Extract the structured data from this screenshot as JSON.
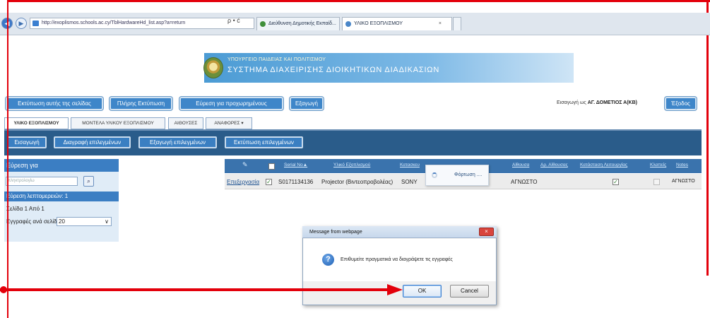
{
  "browser": {
    "url": "http://exoplismos.schools.ac.cy/TblHardwareHd_list.asp?a=return",
    "address_tools": "ρ • ć",
    "tabs": [
      {
        "label": "Διεύθυνση Δημοτικής Εκπαίδ..."
      },
      {
        "label": "ΥΛΙΚΟ ΕΞΟΠΛΙΣΜΟΥ",
        "close": "×"
      }
    ]
  },
  "banner": {
    "line1": "ΥΠΟΥΡΓΕΙΟ ΠΑΙΔΕΙΑΣ ΚΑΙ ΠΟΛΙΤΙΣΜΟΥ",
    "line2": "ΣΥΣΤΗΜΑ ΔΙΑΧΕΙΡΙΣΗΣ ΔΙΟΙΚΗΤΙΚΩΝ ΔΙΑΔΙΚΑΣΙΩΝ"
  },
  "toolbar": {
    "print_page": "Εκτύπωση αυτής της σελίδας",
    "print_all": "Πλήρης Εκτύπωση",
    "advanced_search": "Εύρεση για προχωρημένους",
    "export": "Εξαγωγή",
    "login_prefix": "Εισαγωγή ως",
    "login_user": "ΑΓ. ΔΟΜΕΤΙΟΣ Α(ΚΒ)",
    "logout": "Έξοδος"
  },
  "main_tabs": [
    "ΥΛΙΚΟ ΕΞΟΠΛΙΣΜΟΥ",
    "ΜΟΝΤΕΛΑ ΥΛΙΚΟΥ ΕΞΟΠΛΙΣΜΟΥ",
    "ΑΙΘΟΥΣΕΣ",
    "ΑΝΑΦΟΡΕΣ ▾"
  ],
  "actions": {
    "import": "Εισαγωγή",
    "delete_selected": "Διαγραφή επιλεγμένων",
    "export_selected": "Εξαγωγή επιλεγμένων",
    "print_selected": "Εκτύπωση επιλεγμένων"
  },
  "search_panel": {
    "header": "Εύρεση για",
    "input_value": "πληκτρολογίω",
    "search_icon": "⌕",
    "details": "Εύρεση λεπτομερειών: 1",
    "page": "Σελίδα 1 Από 1",
    "per_page_label": "Εγγραφές ανά σελίδα",
    "per_page_value": "20",
    "caret": "∨"
  },
  "table": {
    "headers": {
      "serial": "Serial No▲",
      "equipment": "Υλικό Εξοπλισμού",
      "manufacturer": "Κατασκευ",
      "room": "Αίθουσα",
      "room_no": "Αρ. Αίθουσας",
      "status": "Κατάσταση Λειτουργίας",
      "stolen": "Κλαπείς",
      "notes": "Notes"
    },
    "row": {
      "edit": "Επεξεργασία",
      "serial": "S0171134136",
      "equipment": "Projector (Βιντεοπροβολέας)",
      "manufacturer": "SONY",
      "room": "ΑΓΝΩΣΤΟ",
      "notes": "ΑΓΝΩΣΤΟ"
    },
    "loading": "Φόρτωση ...."
  },
  "dialog": {
    "title": "Message from webpage",
    "close": "×",
    "icon": "?",
    "message": "Επιθυμείτε πραγματικά να διαγράψετε τις εγγραφές",
    "ok": "OK",
    "cancel": "Cancel"
  },
  "colors": {
    "annotation_red": "#e3000b",
    "toolbar_blue": "#3e86c9",
    "action_bar": "#2a5c8a"
  }
}
